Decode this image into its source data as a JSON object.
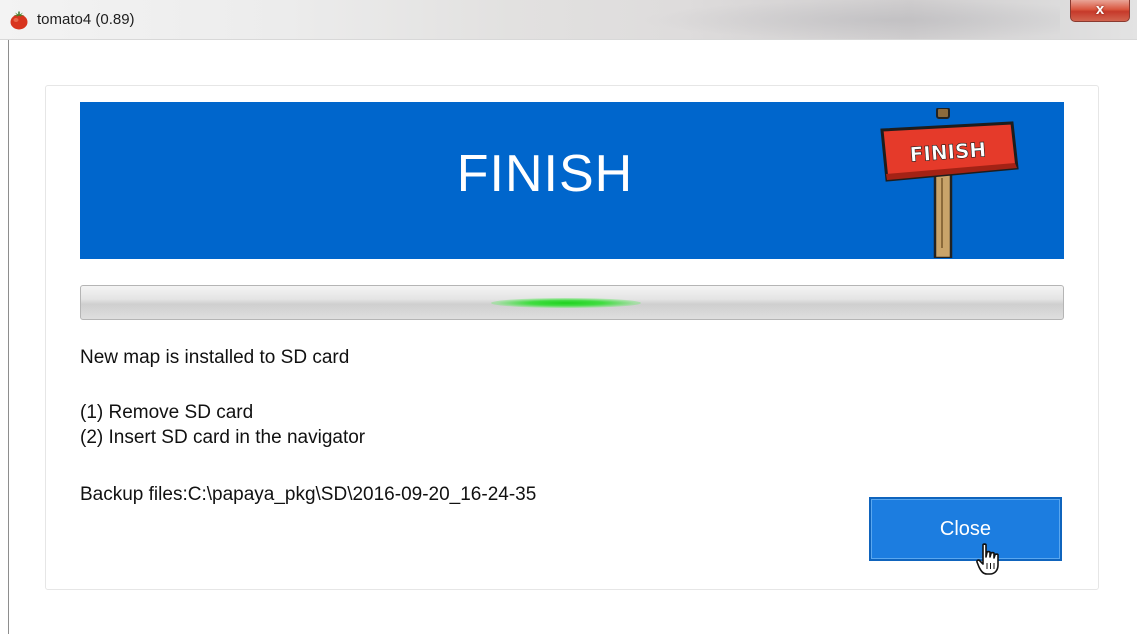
{
  "window": {
    "title": "tomato4 (0.89)",
    "close_glyph": "x",
    "app_icon": "tomato-icon"
  },
  "banner": {
    "title": "FINISH",
    "sign_text": "FINISH",
    "background_color": "#0066cc"
  },
  "progress": {
    "state": "indeterminate",
    "accent_color": "#22d022"
  },
  "messages": {
    "installed": "New map is installed to SD card",
    "step1": "(1) Remove SD card",
    "step2": "(2) Insert SD card in the navigator",
    "backup": "Backup files:C:\\papaya_pkg\\SD\\2016-09-20_16-24-35"
  },
  "buttons": {
    "close_label": "Close",
    "close_color": "#1c7de0"
  }
}
